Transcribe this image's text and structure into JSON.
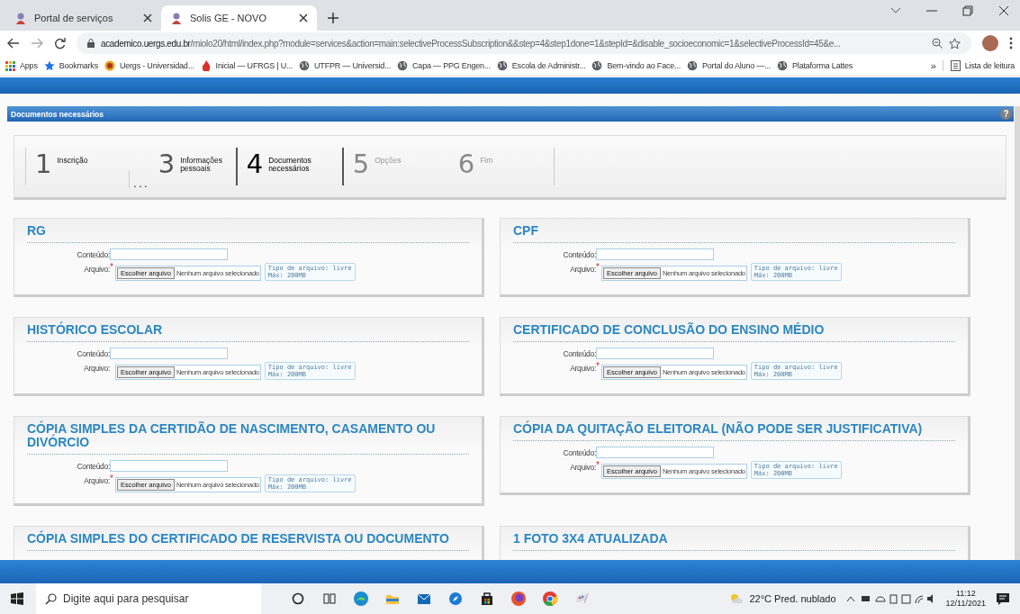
{
  "browser": {
    "tabs": [
      {
        "title": "Portal de serviços",
        "selected": false
      },
      {
        "title": "Solis GE - NOVO",
        "selected": true
      }
    ],
    "url_host": "academico.uergs.edu.br",
    "url_path": "/miolo20/html/index.php?module=services&action=main:selectiveProcessSubscription&&step=4&step1done=1&stepId=&disable_socioeconomic=1&selectiveProcessId=45&e...",
    "bookmarks": [
      {
        "label": "Apps",
        "kind": "apps"
      },
      {
        "label": "Bookmarks",
        "kind": "star"
      },
      {
        "label": "Uergs - Universidad...",
        "kind": "uergs"
      },
      {
        "label": "Inicial — UFRGS | U...",
        "kind": "flame"
      },
      {
        "label": "UTFPR — Universid...",
        "kind": "globe"
      },
      {
        "label": "Capa — PPG Engen...",
        "kind": "globe"
      },
      {
        "label": "Escola de Administr...",
        "kind": "globe"
      },
      {
        "label": "Bem-vindo ao Face...",
        "kind": "globe"
      },
      {
        "label": "Portal do Aluno —...",
        "kind": "globe"
      },
      {
        "label": "Plataforma Lattes",
        "kind": "globe"
      }
    ],
    "more": "»",
    "reading_list": "Lista de leitura"
  },
  "panel": {
    "title": "Documentos necessários",
    "help": "?"
  },
  "steps": [
    {
      "kind": "step",
      "number": "1",
      "label": "Inscrição",
      "selected": false,
      "disabled": false
    },
    {
      "kind": "gap",
      "label": "..."
    },
    {
      "kind": "step",
      "number": "3",
      "label": "Informações pessoais",
      "selected": false,
      "disabled": false
    },
    {
      "kind": "step",
      "number": "4",
      "label": "Documentos necessários",
      "selected": true,
      "disabled": false
    },
    {
      "kind": "step",
      "number": "5",
      "label": "Opções",
      "selected": false,
      "disabled": true
    },
    {
      "kind": "step",
      "number": "6",
      "label": "Fim",
      "selected": false,
      "disabled": true
    }
  ],
  "documents": [
    {
      "title": "RG",
      "content_label": "Conteúdo:",
      "file_label": "Arquivo:",
      "required_mark": "*",
      "choose": "Escolher arquivo",
      "no_file": "Nenhum arquivo selecionado",
      "hint": [
        "Tipo de arquivo: livre",
        "Máx: 200MB"
      ]
    },
    {
      "title": "CPF",
      "content_label": "Conteúdo:",
      "file_label": "Arquivo:",
      "required_mark": "*",
      "choose": "Escolher arquivo",
      "no_file": "Nenhum arquivo selecionado",
      "hint": [
        "Tipo de arquivo: livre",
        "Máx: 200MB"
      ]
    },
    {
      "title": "HISTÓRICO ESCOLAR",
      "content_label": "Conteúdo:",
      "file_label": "Arquivo:",
      "choose": "Escolher arquivo",
      "no_file": "Nenhum arquivo selecionado",
      "hint": [
        "Tipo de arquivo: livre",
        "Máx: 200MB"
      ]
    },
    {
      "title": "CERTIFICADO DE CONCLUSÃO DO ENSINO MÉDIO",
      "content_label": "Conteúdo:",
      "file_label": "Arquivo:",
      "required_mark": "*",
      "choose": "Escolher arquivo",
      "no_file": "Nenhum arquivo selecionado",
      "hint": [
        "Tipo de arquivo: livre",
        "Máx: 200MB"
      ]
    },
    {
      "title": "CÓPIA SIMPLES DA CERTIDÃO DE NASCIMENTO, CASAMENTO OU DIVÓRCIO",
      "content_label": "Conteúdo:",
      "file_label": "Arquivo:",
      "required_mark": "*",
      "choose": "Escolher arquivo",
      "no_file": "Nenhum arquivo selecionado",
      "hint": [
        "Tipo de arquivo: livre",
        "Máx: 200MB"
      ]
    },
    {
      "title": "CÓPIA DA QUITAÇÃO ELEITORAL (NÃO PODE SER JUSTIFICATIVA)",
      "content_label": "Conteúdo:",
      "file_label": "Arquivo:",
      "required_mark": "*",
      "choose": "Escolher arquivo",
      "no_file": "Nenhum arquivo selecionado",
      "hint": [
        "Tipo de arquivo: livre",
        "Máx: 200MB"
      ]
    },
    {
      "title": "CÓPIA SIMPLES DO CERTIFICADO DE RESERVISTA OU DOCUMENTO"
    },
    {
      "title": "1 FOTO 3X4 ATUALIZADA"
    }
  ],
  "taskbar": {
    "search_placeholder": "Digite aqui para pesquisar",
    "apps": [
      {
        "kind": "circle"
      },
      {
        "kind": "taskview"
      },
      {
        "kind": "edge"
      },
      {
        "kind": "folder"
      },
      {
        "kind": "mail"
      },
      {
        "kind": "compass"
      },
      {
        "kind": "store"
      },
      {
        "kind": "firefox"
      },
      {
        "kind": "chrome"
      },
      {
        "kind": "paint"
      }
    ],
    "weather": "22°C Pred. nublado",
    "time": "11:12",
    "date": "12/11/2021"
  }
}
